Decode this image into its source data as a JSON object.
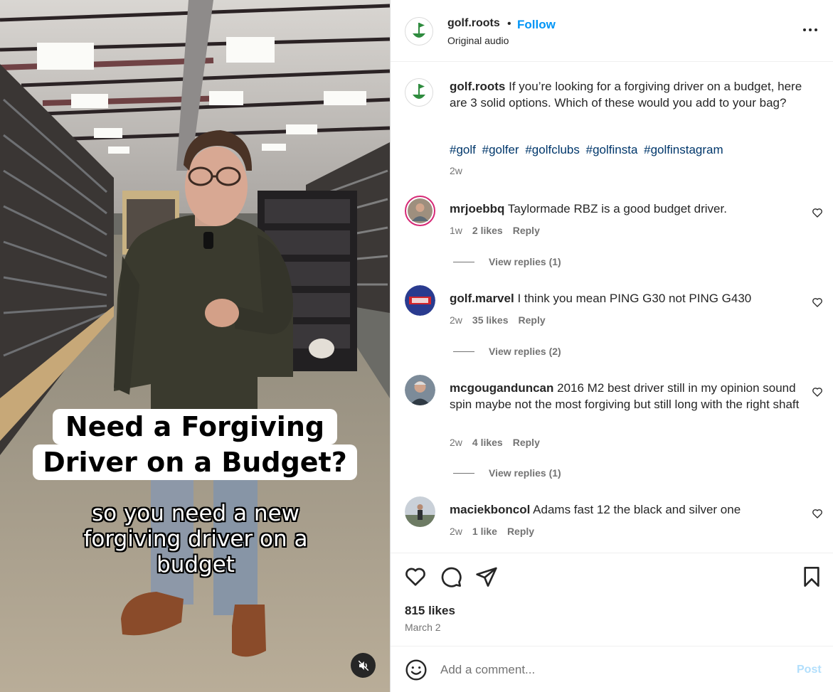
{
  "post": {
    "username": "golf.roots",
    "separator": "•",
    "follow_label": "Follow",
    "audio": "Original audio",
    "caption": "If you’re looking for a forgiving driver on a budget, here are 3 solid options. Which of these would you add to your bag?",
    "hashtags": [
      "#golf",
      "#golfer",
      "#golfclubs",
      "#golfinsta",
      "#golfinstagram"
    ],
    "caption_time": "2w"
  },
  "video": {
    "overlay_line1": "Need a Forgiving",
    "overlay_line2": "Driver on a Budget?",
    "subtitle": "so you need a new forgiving driver on a budget",
    "muted": true
  },
  "comments": [
    {
      "username": "mrjoebbq",
      "text": "Taylormade RBZ is a good budget driver.",
      "time": "1w",
      "likes": "2 likes",
      "reply": "Reply",
      "view_replies": "View replies (1)"
    },
    {
      "username": "golf.marvel",
      "text": "I think you mean PING G30 not PING G430",
      "time": "2w",
      "likes": "35 likes",
      "reply": "Reply",
      "view_replies": "View replies (2)"
    },
    {
      "username": "mcgouganduncan",
      "text": "2016 M2 best driver still in my opinion sound spin maybe not the most forgiving but still long with the right shaft",
      "time": "2w",
      "likes": "4 likes",
      "reply": "Reply",
      "view_replies": "View replies (1)"
    },
    {
      "username": "maciekboncol",
      "text": "Adams fast 12 the black and silver one",
      "time": "2w",
      "likes": "1 like",
      "reply": "Reply"
    }
  ],
  "actions": {
    "likes_count": "815 likes",
    "date": "March 2"
  },
  "composer": {
    "placeholder": "Add a comment...",
    "post_label": "Post"
  },
  "colors": {
    "accent": "#0095f6",
    "hashtag": "#00376b",
    "muted_text": "#737373",
    "post_disabled": "#b2dffc"
  },
  "icons": [
    "golf-roots-logo-icon",
    "more-options-icon",
    "heart-icon",
    "comment-icon",
    "share-icon",
    "bookmark-icon",
    "emoji-icon",
    "mute-icon"
  ]
}
